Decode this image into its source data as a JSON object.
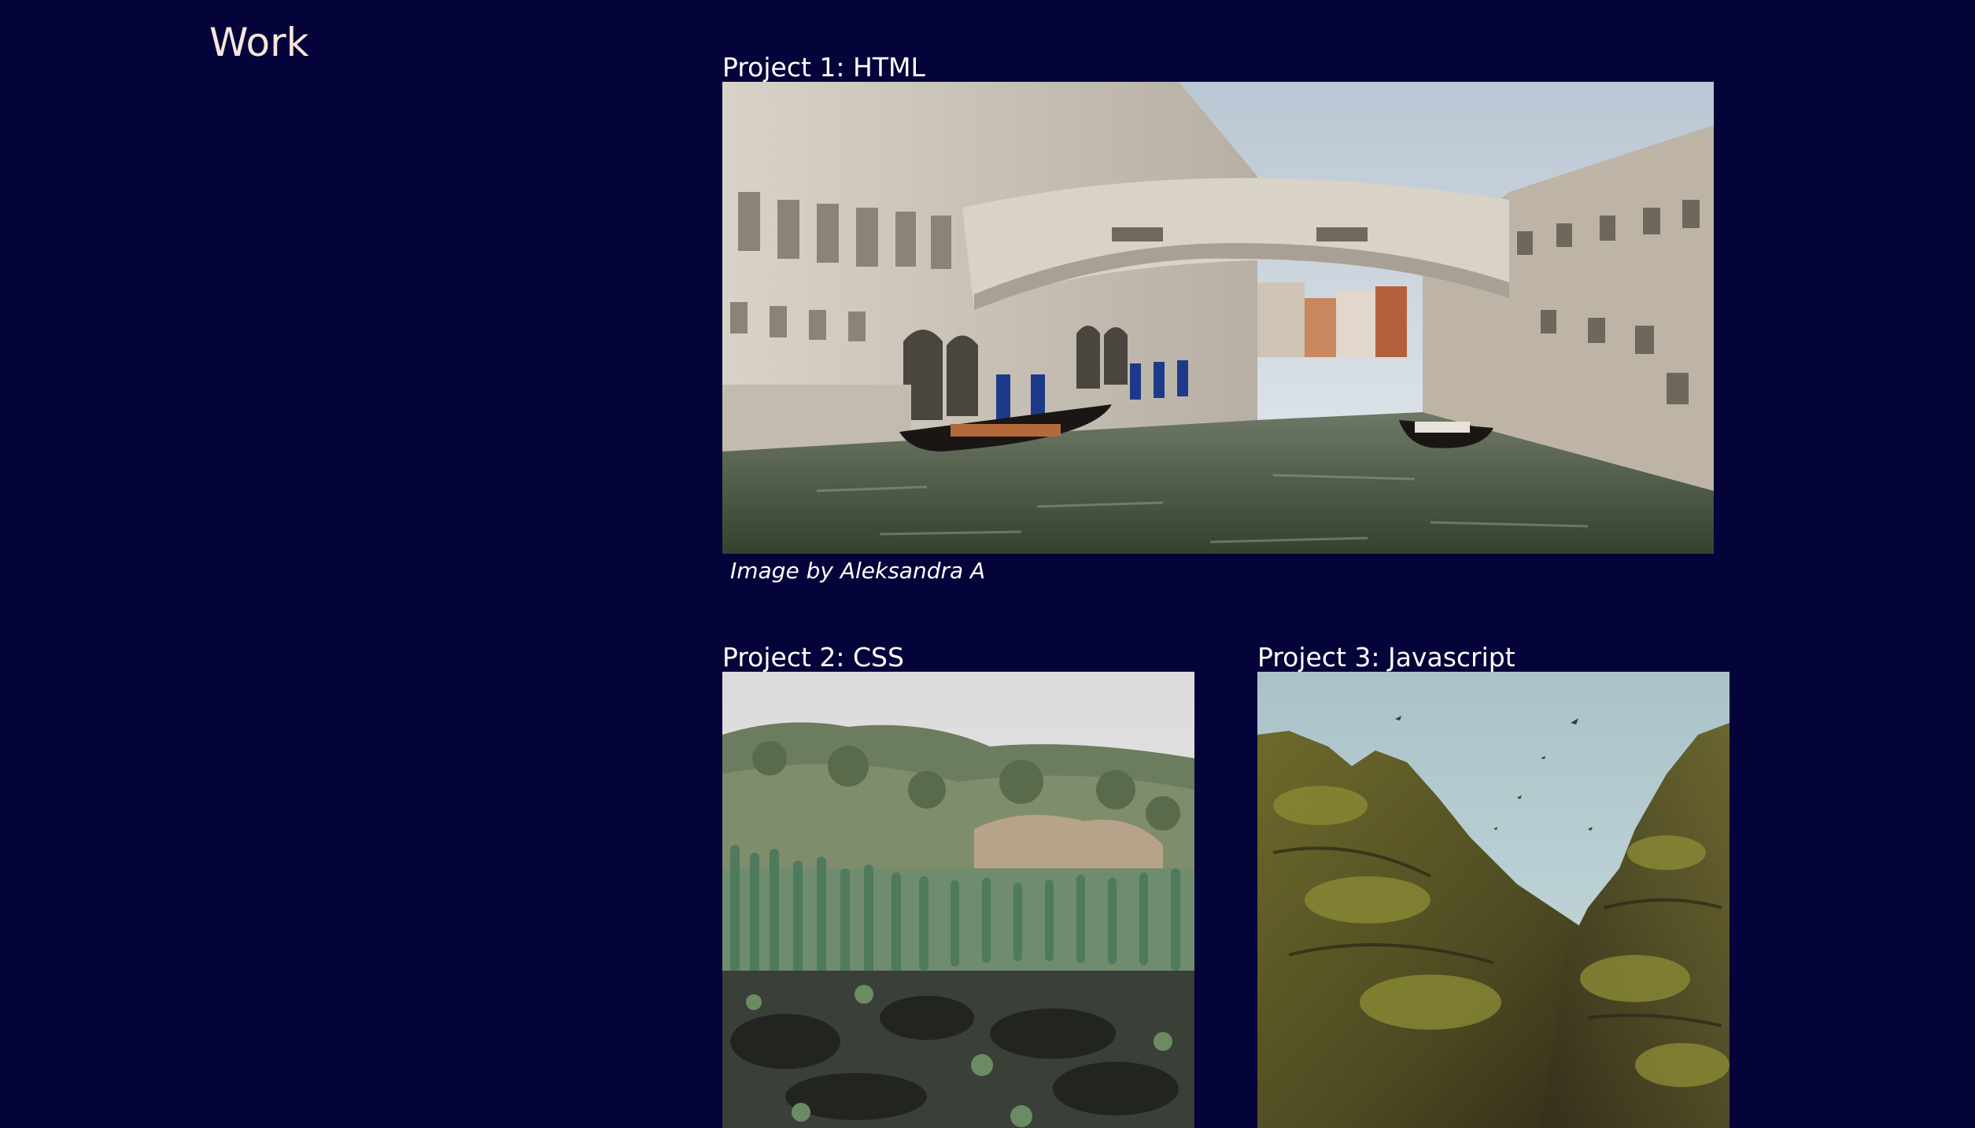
{
  "work_section": {
    "title": "Work"
  },
  "projects": [
    {
      "title": "Project 1: HTML",
      "image_subject": "venice-bridge-of-sighs-photo",
      "caption": "Image by Aleksandra A"
    },
    {
      "title": "Project 2: CSS",
      "image_subject": "cactus-hillside-photo"
    },
    {
      "title": "Project 3: Javascript",
      "image_subject": "mossy-rock-canyon-photo"
    }
  ],
  "colors": {
    "background": "#04043a",
    "heading": "#f7e6dc",
    "text": "#ffffff"
  }
}
